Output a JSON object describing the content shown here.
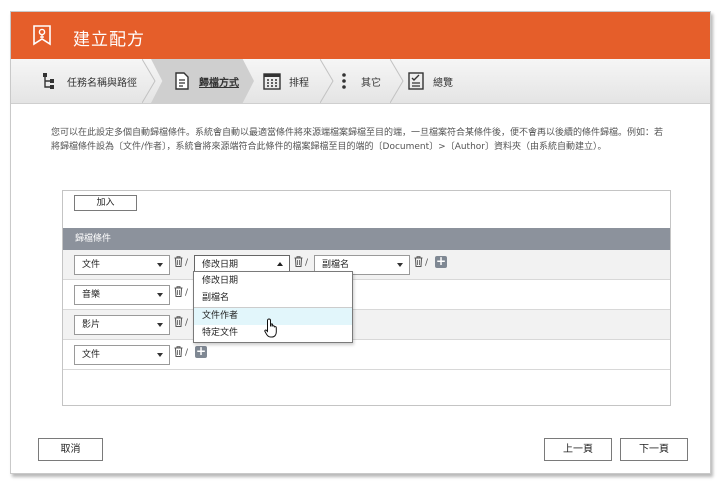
{
  "window": {
    "title": "建立配方"
  },
  "steps": [
    {
      "label": "任務名稱與路徑",
      "icon": "hierarchy-icon",
      "active": false
    },
    {
      "label": "歸檔方式",
      "icon": "document-icon",
      "active": true
    },
    {
      "label": "排程",
      "icon": "calendar-icon",
      "active": false
    },
    {
      "label": "其它",
      "icon": "more-vertical-icon",
      "active": false
    },
    {
      "label": "總覽",
      "icon": "checklist-icon",
      "active": false
    }
  ],
  "description": "您可以在此設定多個自動歸檔條件。系統會自動以最適當條件將來源端檔案歸檔至目的端，一旦檔案符合某條件後，便不會再以後續的條件歸檔。例如：若將歸檔條件設為〔文件/作者〕，系統會將來源端符合此條件的檔案歸檔至目的端的〔Document〕>〔Author〕資料夾（由系統自動建立）。",
  "add_button": "加入",
  "section_title": "歸檔條件",
  "rules": [
    {
      "type": "文件",
      "condition": "修改日期",
      "sub": "副檔名"
    },
    {
      "type": "音樂"
    },
    {
      "type": "影片"
    },
    {
      "type": "文件"
    }
  ],
  "separator": "/",
  "plus_label": "+",
  "dropdown": {
    "options": [
      "修改日期",
      "副檔名",
      "文件作者",
      "特定文件"
    ],
    "highlighted": "文件作者"
  },
  "footer": {
    "cancel": "取消",
    "prev": "上一頁",
    "next": "下一頁"
  },
  "colors": {
    "accent": "#e55e2a",
    "section": "#8c929c",
    "highlight": "#e2f6fb"
  }
}
